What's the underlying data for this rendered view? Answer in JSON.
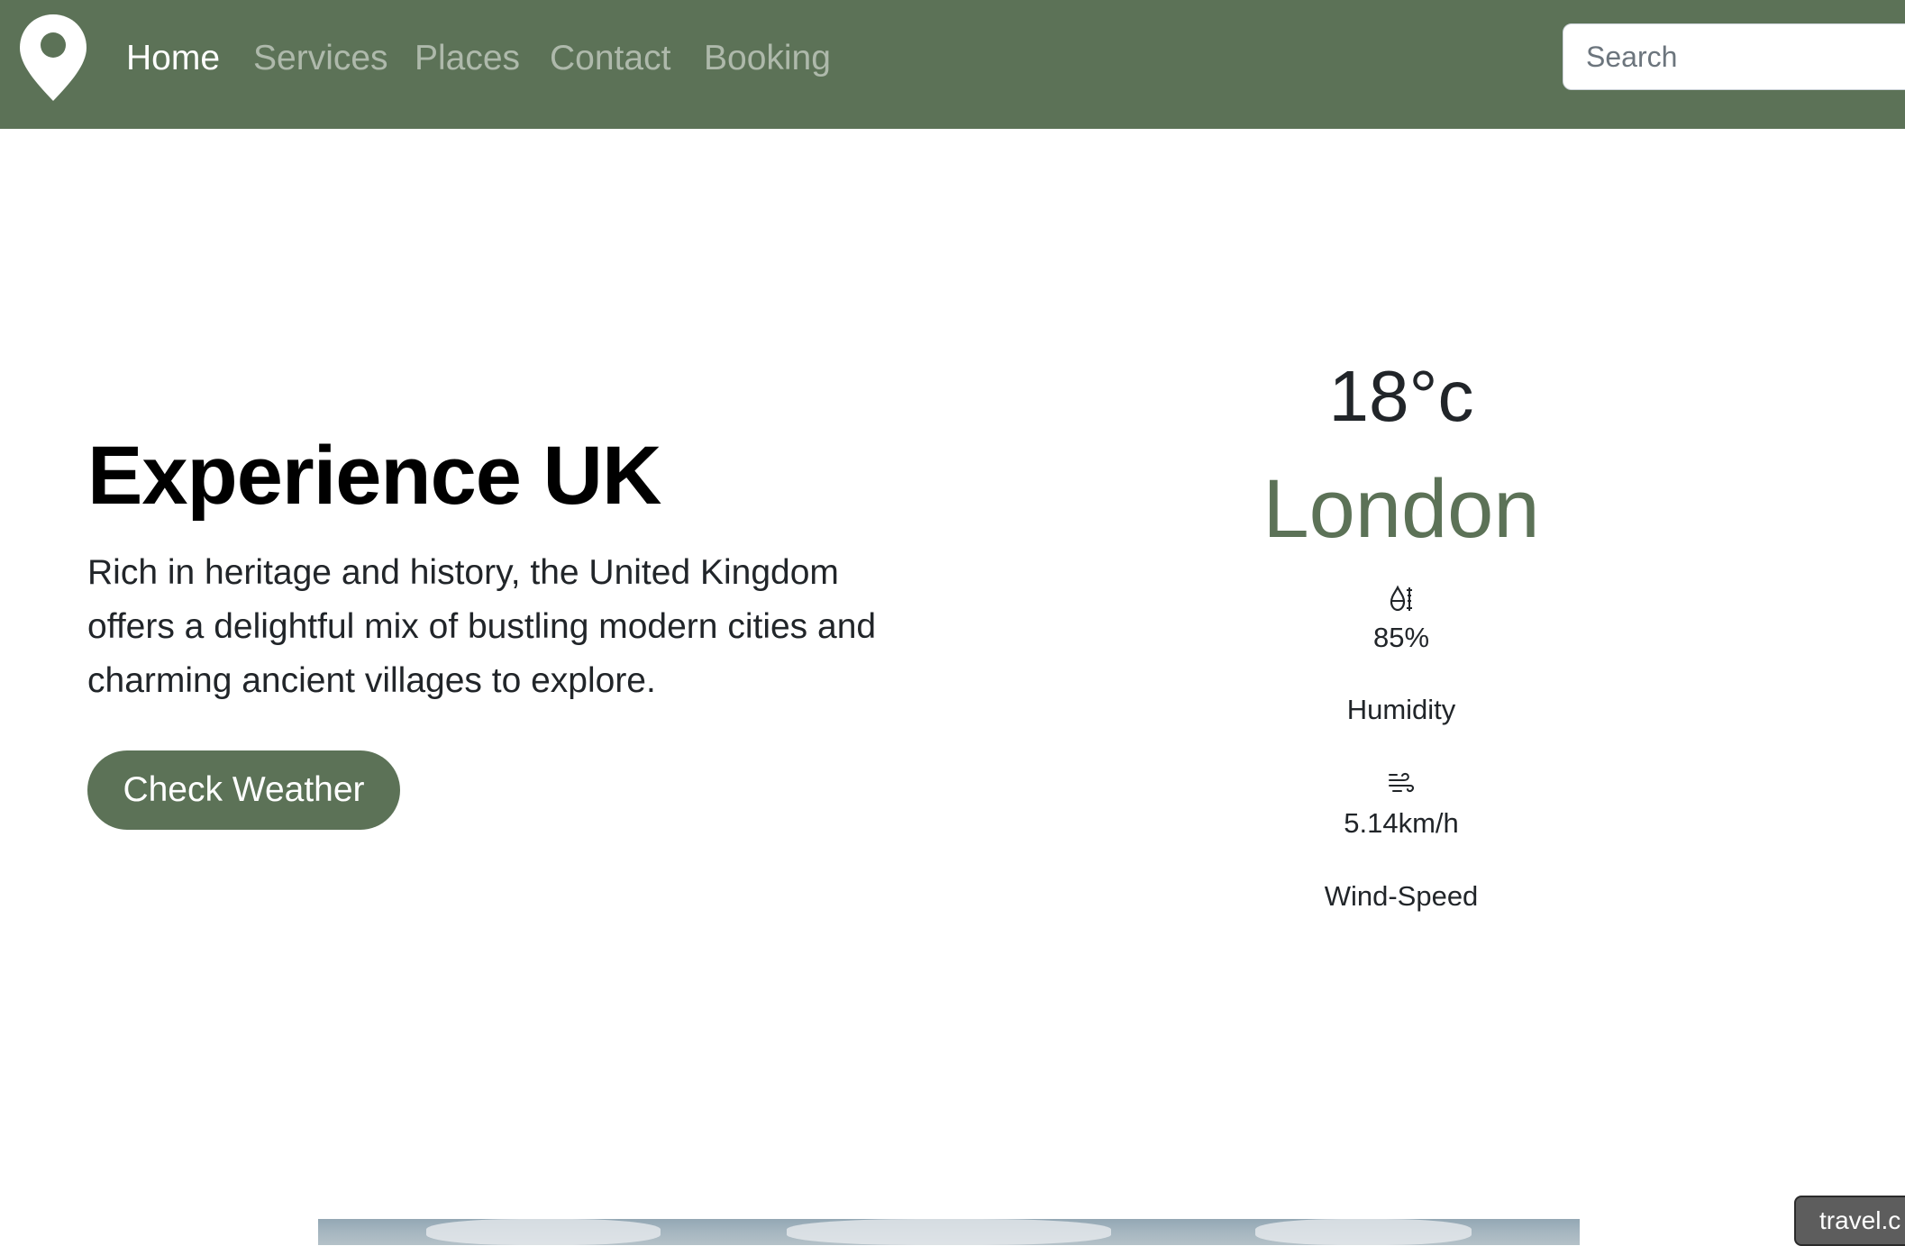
{
  "navbar": {
    "logo_icon": "map-pin-icon",
    "links": [
      {
        "label": "Home",
        "active": true
      },
      {
        "label": "Services",
        "active": false
      },
      {
        "label": "Places",
        "active": false
      },
      {
        "label": "Contact",
        "active": false
      },
      {
        "label": "Booking",
        "active": false
      }
    ],
    "search": {
      "placeholder": "Search",
      "value": ""
    }
  },
  "hero": {
    "title": "Experience UK",
    "description": "Rich in heritage and history, the United Kingdom offers a delightful mix of bustling modern cities and charming ancient villages to explore.",
    "button_label": "Check Weather"
  },
  "weather": {
    "temperature": "18°c",
    "city": "London",
    "humidity": {
      "icon": "humidity-icon",
      "value": "85%",
      "label": "Humidity"
    },
    "wind": {
      "icon": "wind-icon",
      "value": "5.14km/h",
      "label": "Wind-Speed"
    }
  },
  "footer_badge": "travel.c",
  "colors": {
    "brand": "#5c7257",
    "nav_inactive": "rgba(255,255,255,0.5)",
    "text": "#212529"
  }
}
